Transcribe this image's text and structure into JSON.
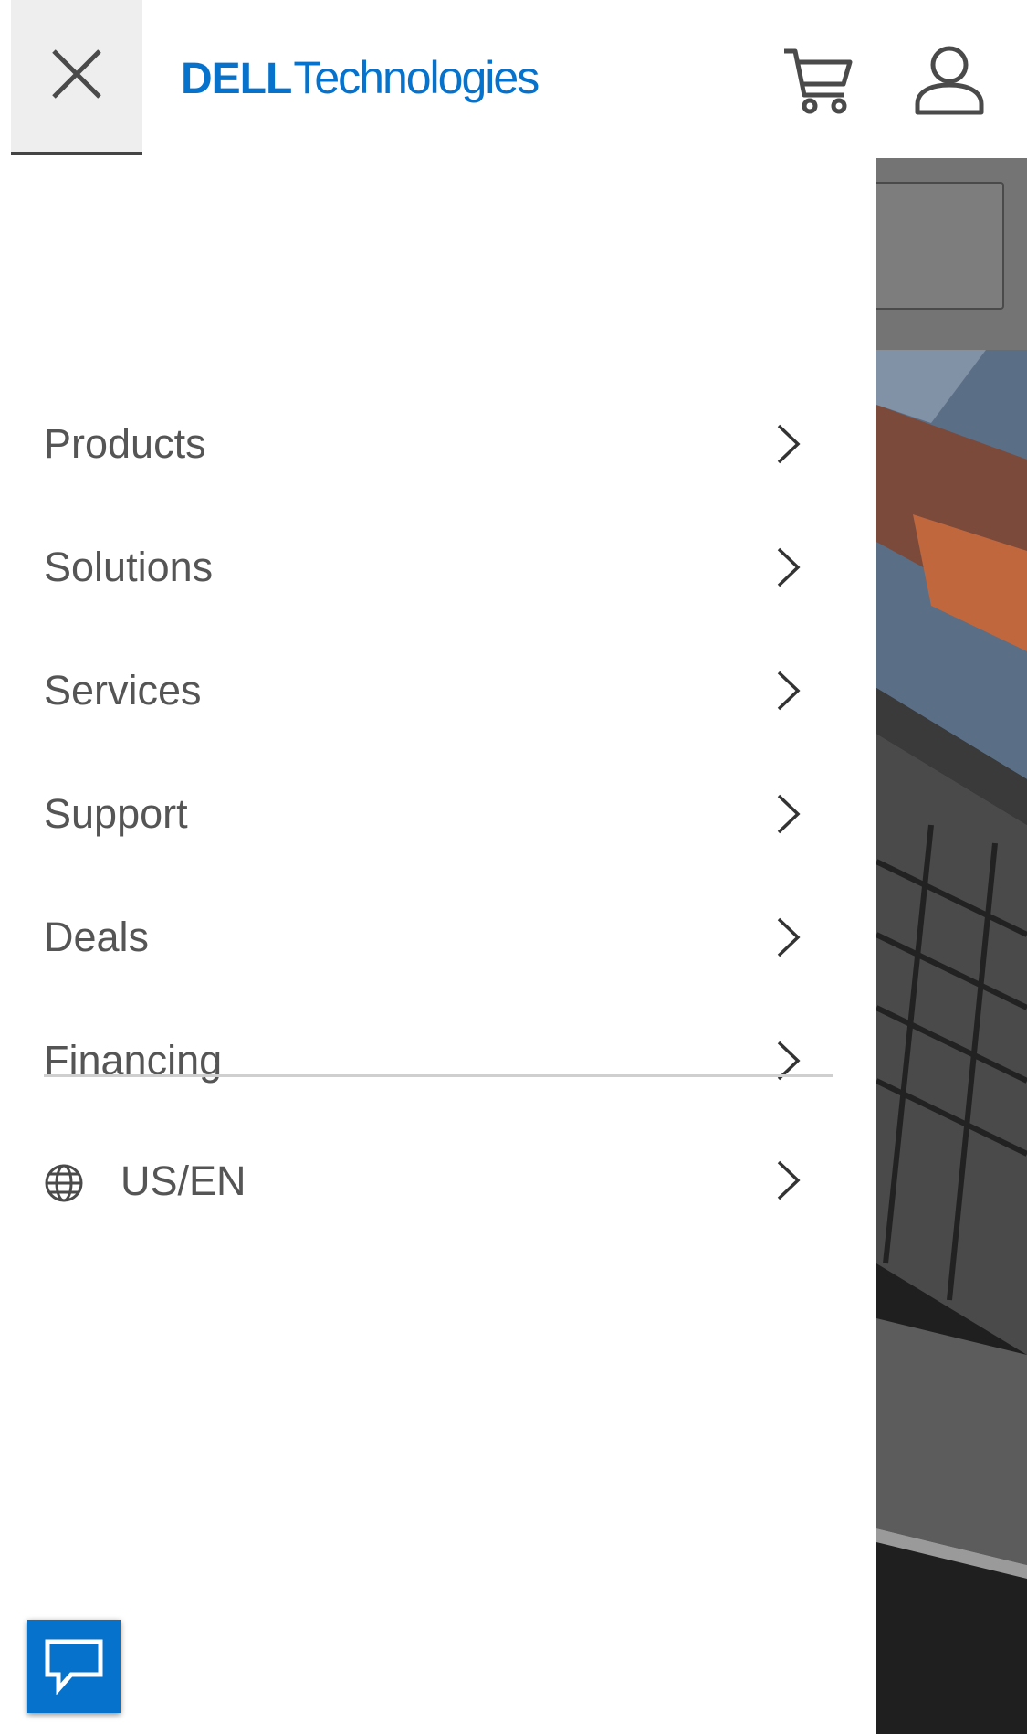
{
  "header": {
    "logo": {
      "brand": "DELL",
      "suffix": "Technologies"
    },
    "icons": {
      "close": "close-icon",
      "cart": "cart-icon",
      "account": "account-icon"
    }
  },
  "menu": {
    "items": [
      {
        "label": "Products"
      },
      {
        "label": "Solutions"
      },
      {
        "label": "Services"
      },
      {
        "label": "Support"
      },
      {
        "label": "Deals"
      },
      {
        "label": "Financing"
      }
    ],
    "locale": {
      "label": "US/EN",
      "icon": "globe-icon"
    }
  },
  "chat": {
    "icon": "chat-icon"
  },
  "colors": {
    "brand": "#0672cb",
    "text": "#555555",
    "close_bg": "#eeeeee"
  }
}
